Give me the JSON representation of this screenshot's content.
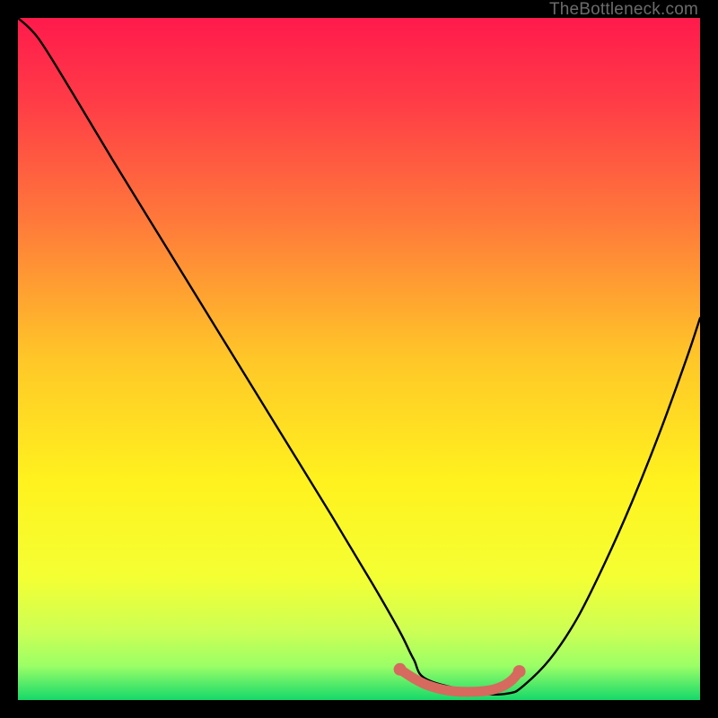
{
  "watermark": "TheBottleneck.com",
  "chart_data": {
    "type": "line",
    "title": "",
    "xlabel": "",
    "ylabel": "",
    "xlim": [
      0,
      100
    ],
    "ylim": [
      0,
      100
    ],
    "grid": false,
    "legend": false,
    "gradient_stops": [
      {
        "offset": 0.0,
        "color": "#ff1a4c"
      },
      {
        "offset": 0.12,
        "color": "#ff3b47"
      },
      {
        "offset": 0.3,
        "color": "#ff7a3a"
      },
      {
        "offset": 0.5,
        "color": "#ffc728"
      },
      {
        "offset": 0.68,
        "color": "#fff21e"
      },
      {
        "offset": 0.82,
        "color": "#f4ff33"
      },
      {
        "offset": 0.9,
        "color": "#ccff55"
      },
      {
        "offset": 0.95,
        "color": "#9bff66"
      },
      {
        "offset": 1.0,
        "color": "#15d96a"
      }
    ],
    "series": [
      {
        "name": "bottleneck-curve",
        "x": [
          0.0,
          3,
          8,
          14,
          22,
          30,
          38,
          46,
          52,
          56,
          58,
          60,
          68,
          72,
          74,
          78,
          82,
          86,
          90,
          94,
          98,
          100
        ],
        "y": [
          100,
          97,
          89,
          79,
          66,
          53,
          40,
          27,
          17,
          10,
          6,
          3,
          1,
          1,
          2,
          6,
          12,
          20,
          29,
          39,
          50,
          56
        ]
      }
    ],
    "highlight_segment": {
      "name": "optimal-range",
      "color": "#d66a5f",
      "x": [
        56,
        58,
        60,
        63,
        66,
        69,
        71,
        72.5,
        73.5
      ],
      "y": [
        4.5,
        3.2,
        2.2,
        1.4,
        1.2,
        1.4,
        2.0,
        3.0,
        4.2
      ]
    },
    "highlight_dots": [
      {
        "x": 56,
        "y": 4.5
      },
      {
        "x": 73.5,
        "y": 4.2
      }
    ]
  }
}
